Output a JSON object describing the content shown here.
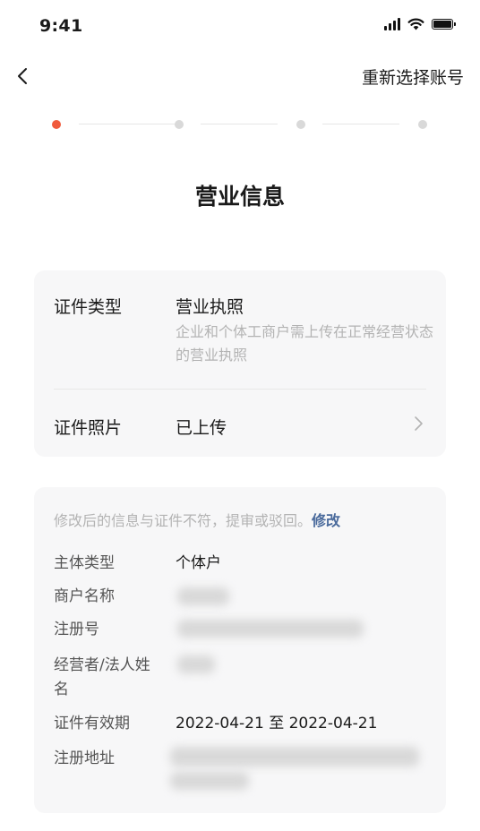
{
  "status_bar": {
    "time": "9:41"
  },
  "nav": {
    "reselect_label": "重新选择账号"
  },
  "steps": {
    "total": 4,
    "current": 1
  },
  "title": "营业信息",
  "certificate": {
    "type_label": "证件类型",
    "type_value": "营业执照",
    "type_hint": "企业和个体工商户需上传在正常经营状态的营业执照",
    "photo_label": "证件照片",
    "photo_value": "已上传"
  },
  "info": {
    "notice": "修改后的信息与证件不符，提审或驳回。",
    "modify_label": "修改",
    "fields": {
      "subject_type": {
        "label": "主体类型",
        "value": "个体户"
      },
      "merchant_name": {
        "label": "商户名称"
      },
      "reg_no": {
        "label": "注册号"
      },
      "legal_person": {
        "label": "经营者/法人姓名"
      },
      "validity": {
        "label": "证件有效期",
        "value": "2022-04-21 至 2022-04-21"
      },
      "address": {
        "label": "注册地址"
      }
    }
  },
  "colors": {
    "accent": "#f05a3c",
    "link": "#4a6a9c"
  }
}
